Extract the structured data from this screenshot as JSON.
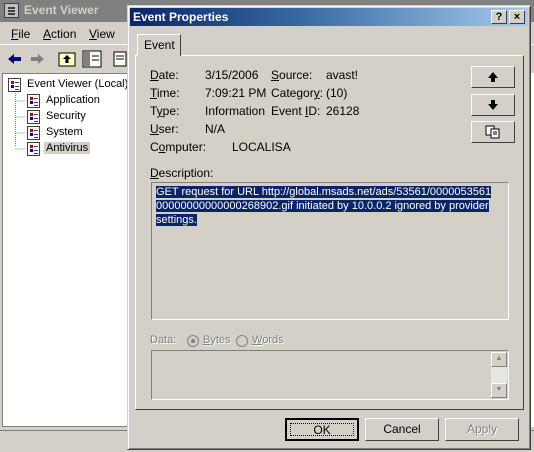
{
  "main_window": {
    "title": "Event Viewer",
    "menu": [
      {
        "label": "File",
        "accel": "F",
        "rest": "ile"
      },
      {
        "label": "Action",
        "accel": "A",
        "rest": "ction"
      },
      {
        "label": "View",
        "accel": "V",
        "rest": "iew"
      }
    ],
    "toolbar_icons": [
      "back-arrow-icon",
      "forward-arrow-icon",
      "up-folder-icon",
      "show-hide-tree-icon",
      "properties-icon"
    ],
    "tree": [
      {
        "label": "Event Viewer (Local)",
        "selected": false
      },
      {
        "label": "Application",
        "selected": false
      },
      {
        "label": "Security",
        "selected": false
      },
      {
        "label": "System",
        "selected": false
      },
      {
        "label": "Antivirus",
        "selected": true
      }
    ]
  },
  "dialog": {
    "title": "Event Properties",
    "caption_buttons": {
      "help": "?",
      "close": "×"
    },
    "tab": "Event",
    "fields": {
      "date_label": "Date:",
      "date_accel": "D",
      "date_rest": "ate:",
      "date_value": "3/15/2006",
      "source_label": "Source:",
      "source_accel": "S",
      "source_rest": "ource:",
      "source_value": "avast!",
      "time_label": "Time:",
      "time_accel": "T",
      "time_rest": "ime:",
      "time_value": "7:09:21 PM",
      "category_label": "Category:",
      "category_accel": "y",
      "category_pre": "Categor",
      "category_post": ":",
      "category_value": "(10)",
      "type_label": "Type:",
      "type_accel": "y",
      "type_pre": "T",
      "type_post": "pe:",
      "type_value": "Information",
      "eventid_label": "Event ID:",
      "eventid_pre": "Event ",
      "eventid_accel": "I",
      "eventid_post": "D:",
      "eventid_value": "26128",
      "user_label": "User:",
      "user_accel": "U",
      "user_rest": "ser:",
      "user_value": "N/A",
      "computer_label": "Computer:",
      "computer_pre": "C",
      "computer_accel": "o",
      "computer_post": "mputer:",
      "computer_value": "LOCALISA"
    },
    "nav_buttons": {
      "up": "🡅",
      "down": "🡇",
      "copy": "copy"
    },
    "description_label": {
      "accel": "D",
      "rest": "escription:"
    },
    "description_lines": [
      "GET request for URL http://global.msads.net/ads/53561/0000053561",
      "00000000000000268902.gif initiated by 10.0.0.2 ignored by provider",
      "settings."
    ],
    "data_label": "Data:",
    "data_format": {
      "bytes_accel": "B",
      "bytes_rest": "ytes",
      "words_accel": "W",
      "words_rest": "ords",
      "selected": "Bytes"
    },
    "buttons": {
      "ok": "OK",
      "cancel": "Cancel",
      "apply": "Apply"
    }
  }
}
